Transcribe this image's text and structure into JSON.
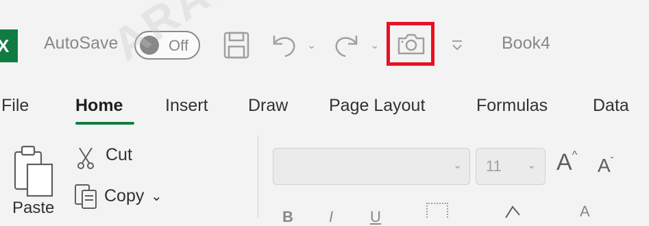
{
  "titlebar": {
    "app_icon": "excel-icon",
    "app_letter": "X",
    "autosave_label": "AutoSave",
    "autosave_state": "Off",
    "save_icon": "save-icon",
    "undo_icon": "undo-icon",
    "redo_icon": "redo-icon",
    "camera_icon": "camera-icon",
    "customize_icon": "customize-qat-icon",
    "document_title": "Book4",
    "highlight_color": "#e81123"
  },
  "ribbon": {
    "tabs": [
      "File",
      "Home",
      "Insert",
      "Draw",
      "Page Layout",
      "Formulas",
      "Data"
    ],
    "active_tab": "Home",
    "accent_color": "#107c41"
  },
  "clipboard": {
    "paste_label": "Paste",
    "cut_label": "Cut",
    "copy_label": "Copy"
  },
  "font": {
    "size": "11",
    "grow_label": "A",
    "shrink_label": "A"
  },
  "watermark": "ARABI"
}
